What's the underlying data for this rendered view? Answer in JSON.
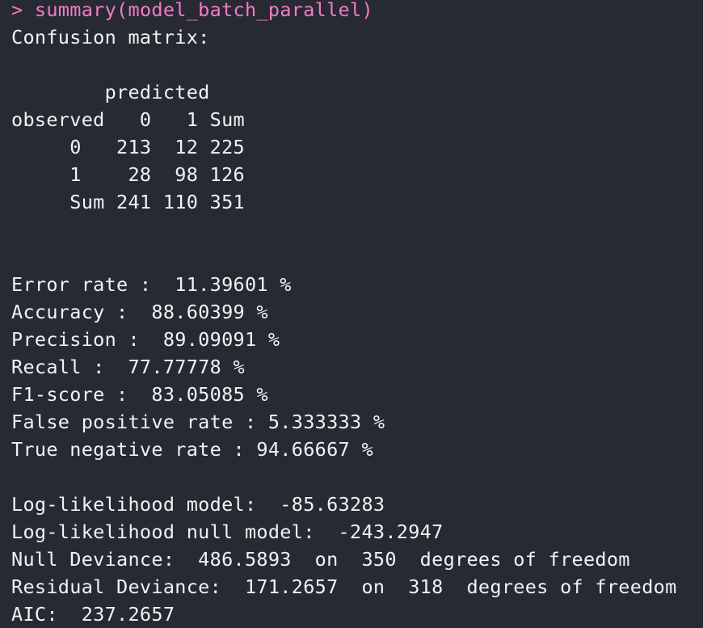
{
  "console": {
    "prompt": "> ",
    "command": "summary(model_batch_parallel)",
    "prompt_color": "#f47bc8",
    "text_color": "#f2f2f2",
    "background_color": "#272a33"
  },
  "confusion_matrix": {
    "title": "Confusion matrix:",
    "header_line": "        predicted",
    "column_header": "observed   0   1 Sum",
    "rows": [
      "     0   213  12 225",
      "     1    28  98 126",
      "     Sum 241 110 351"
    ]
  },
  "metrics": [
    "Error rate :  11.39601 %",
    "Accuracy :  88.60399 %",
    "Precision :  89.09091 %",
    "Recall :  77.77778 %",
    "F1-score :  83.05085 %",
    "False positive rate : 5.333333 %",
    "True negative rate : 94.66667 %"
  ],
  "model_stats": [
    "Log-likelihood model:  -85.63283",
    "Log-likelihood null model:  -243.2947",
    "Null Deviance:  486.5893  on  350  degrees of freedom",
    "Residual Deviance:  171.2657  on  318  degrees of freedom",
    "AIC:  237.2657"
  ]
}
